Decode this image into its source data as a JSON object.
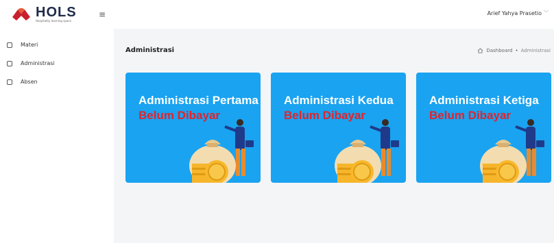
{
  "brand": {
    "name": "HOLS",
    "tagline": "Hospitality learning space"
  },
  "header": {
    "user_name": "Arief Yahya Prasetio"
  },
  "sidebar": {
    "items": [
      {
        "label": "Materi"
      },
      {
        "label": "Administrasi"
      },
      {
        "label": "Absen"
      }
    ]
  },
  "page": {
    "title": "Administrasi",
    "breadcrumb": {
      "home": "Dashboard",
      "separator": "•",
      "current": "Administrasi"
    }
  },
  "cards": [
    {
      "title": "Administrasi Pertama",
      "status": "Belum Dibayar"
    },
    {
      "title": "Administrasi Kedua",
      "status": "Belum Dibayar"
    },
    {
      "title": "Administrasi Ketiga",
      "status": "Belum Dibayar"
    }
  ],
  "colors": {
    "card_bg": "#1aa3f0",
    "status_text": "#e0242c",
    "brand_red": "#c8202e",
    "content_bg": "#f4f5f7"
  },
  "icons": [
    "hols-logo-icon",
    "hamburger-icon",
    "chevron-down-icon",
    "checkbox-icon",
    "home-icon",
    "money-bag-icon"
  ]
}
